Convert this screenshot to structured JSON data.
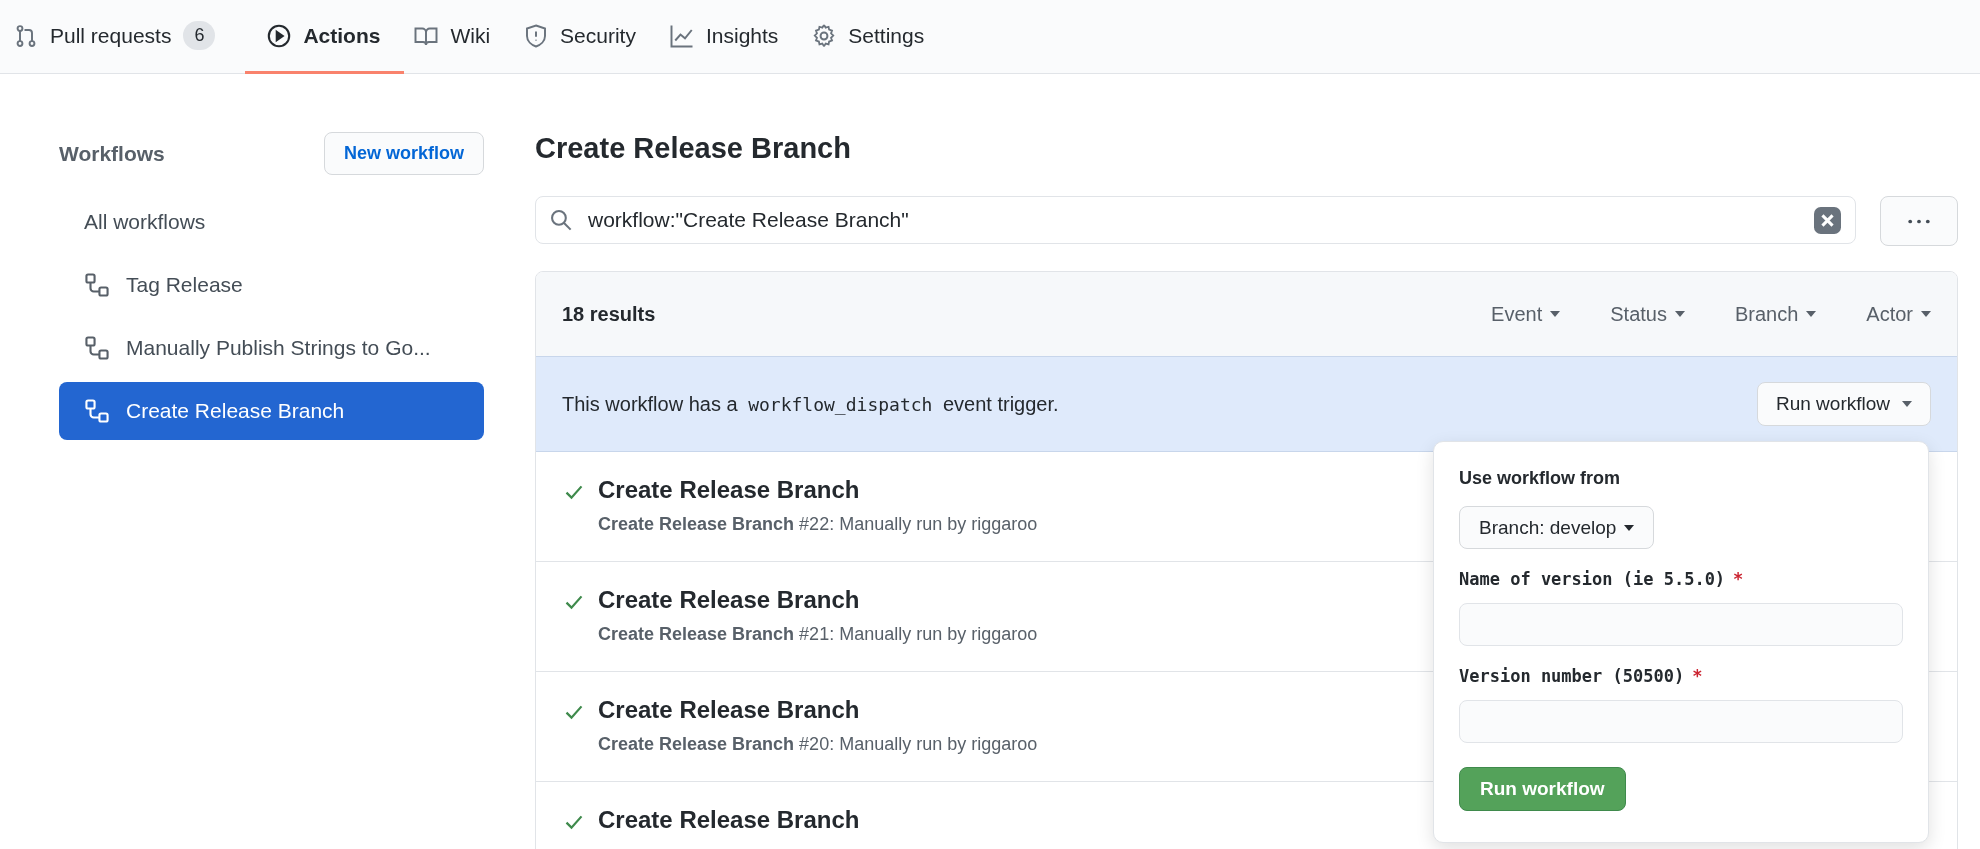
{
  "tabs": [
    {
      "label": "Pull requests",
      "kind": "pull-request",
      "count": "6",
      "selected": false
    },
    {
      "label": "Actions",
      "kind": "play",
      "selected": true
    },
    {
      "label": "Wiki",
      "kind": "book",
      "selected": false
    },
    {
      "label": "Security",
      "kind": "shield",
      "selected": false
    },
    {
      "label": "Insights",
      "kind": "graph",
      "selected": false
    },
    {
      "label": "Settings",
      "kind": "gear",
      "selected": false
    }
  ],
  "sidebar": {
    "heading": "Workflows",
    "new_button": "New workflow",
    "items": [
      {
        "label": "All workflows",
        "kind": "all",
        "selected": false
      },
      {
        "label": "Tag Release",
        "kind": "workflow",
        "selected": false
      },
      {
        "label": "Manually Publish Strings to Go...",
        "kind": "workflow",
        "selected": false
      },
      {
        "label": "Create Release Branch",
        "kind": "workflow",
        "selected": true
      }
    ]
  },
  "main": {
    "title": "Create Release Branch",
    "search": "workflow:\"Create Release Branch\"",
    "results": "18 results",
    "filters": [
      "Event",
      "Status",
      "Branch",
      "Actor"
    ],
    "banner": {
      "before": "This workflow has a",
      "code": "workflow_dispatch",
      "after": "event trigger.",
      "button": "Run workflow"
    },
    "runs": [
      {
        "title": "Create Release Branch",
        "detail": "**Create Release Branch** #22: Manually run by riggaroo",
        "succeeded": true
      },
      {
        "title": "Create Release Branch",
        "detail": "**Create Release Branch** #21: Manually run by riggaroo",
        "succeeded": true
      },
      {
        "title": "Create Release Branch",
        "detail": "**Create Release Branch** #20: Manually run by riggaroo",
        "succeeded": true
      },
      {
        "title": "Create Release Branch",
        "succeeded": true
      }
    ]
  },
  "popup": {
    "heading": "Use workflow from",
    "branch_button": "Branch: develop",
    "inputs": [
      {
        "label": "Name of version (ie 5.5.0)",
        "required_mark": "*"
      },
      {
        "label": "Version number (50500)",
        "required_mark": "*"
      }
    ],
    "submit": "Run workflow"
  }
}
